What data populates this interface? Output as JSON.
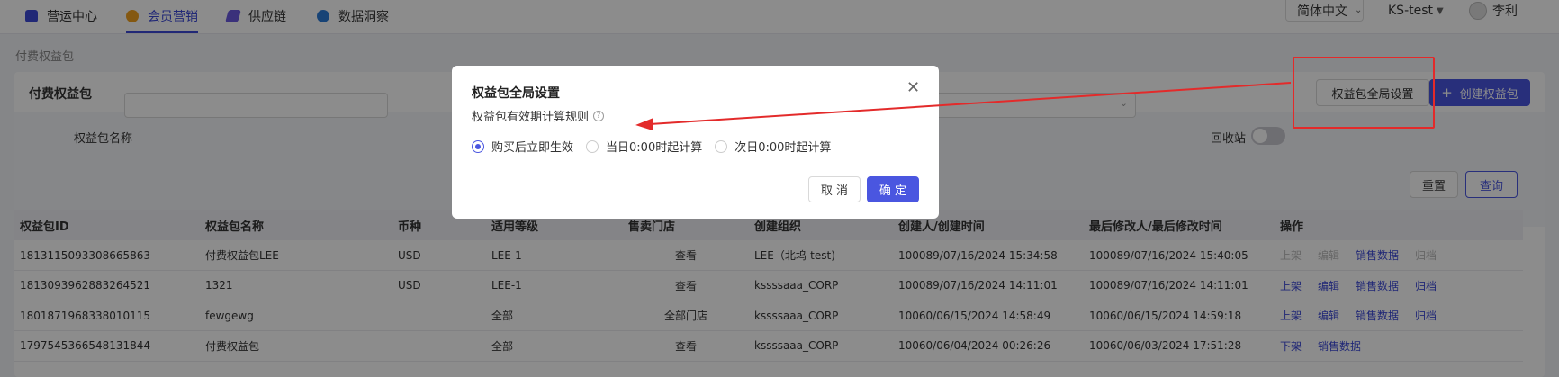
{
  "topbar": {
    "nav": [
      {
        "label": "营运中心",
        "icon": "operations-icon",
        "color": "#3d4ad8"
      },
      {
        "label": "会员营销",
        "icon": "member-marketing-icon",
        "color": "#f0a020"
      },
      {
        "label": "供应链",
        "icon": "supply-chain-icon",
        "color": "#6a5ae0"
      },
      {
        "label": "数据洞察",
        "icon": "data-insight-icon",
        "color": "#2b7ad8"
      }
    ],
    "active_nav_index": 1,
    "language": "简体中文",
    "tenant": "KS-test",
    "user": "李利"
  },
  "breadcrumb": "付费权益包",
  "card": {
    "title": "付费权益包",
    "global_settings_button": "权益包全局设置",
    "create_button": "创建权益包"
  },
  "filter": {
    "name_label": "权益包名称",
    "recycle_label": "回收站",
    "reset_button": "重置",
    "search_button": "查询"
  },
  "table": {
    "columns": [
      "权益包ID",
      "权益包名称",
      "币种",
      "适用等级",
      "售卖门店",
      "创建组织",
      "创建人/创建时间",
      "最后修改人/最后修改时间",
      "操作"
    ],
    "rows": [
      {
        "id": "1813115093308665863",
        "name": "付费权益包LEE",
        "currency": "USD",
        "level": "LEE-1",
        "store": "查看",
        "store_link": true,
        "org": "LEE（北坞-test)",
        "created": "100089/07/16/2024 15:34:58",
        "modified": "100089/07/16/2024 15:40:05",
        "actions": [
          {
            "label": "上架",
            "enabled": false
          },
          {
            "label": "编辑",
            "enabled": false
          },
          {
            "label": "销售数据",
            "enabled": true
          },
          {
            "label": "归档",
            "enabled": false
          }
        ]
      },
      {
        "id": "1813093962883264521",
        "name": "1321",
        "currency": "USD",
        "level": "LEE-1",
        "store": "查看",
        "store_link": true,
        "org": "kssssaaa_CORP",
        "created": "100089/07/16/2024 14:11:01",
        "modified": "100089/07/16/2024 14:11:01",
        "actions": [
          {
            "label": "上架",
            "enabled": true
          },
          {
            "label": "编辑",
            "enabled": true
          },
          {
            "label": "销售数据",
            "enabled": true
          },
          {
            "label": "归档",
            "enabled": true
          }
        ]
      },
      {
        "id": "1801871968338010115",
        "name": "fewgewg",
        "currency": "",
        "level": "全部",
        "store": "全部门店",
        "store_link": false,
        "org": "kssssaaa_CORP",
        "created": "10060/06/15/2024 14:58:49",
        "modified": "10060/06/15/2024 14:59:18",
        "actions": [
          {
            "label": "上架",
            "enabled": true
          },
          {
            "label": "编辑",
            "enabled": true
          },
          {
            "label": "销售数据",
            "enabled": true
          },
          {
            "label": "归档",
            "enabled": true
          }
        ]
      },
      {
        "id": "1797545366548131844",
        "name": "付费权益包",
        "currency": "",
        "level": "全部",
        "store": "查看",
        "store_link": true,
        "org": "kssssaaa_CORP",
        "created": "10060/06/04/2024 00:26:26",
        "modified": "10060/06/03/2024 17:51:28",
        "actions": [
          {
            "label": "下架",
            "enabled": true
          },
          {
            "label": "销售数据",
            "enabled": true
          }
        ]
      }
    ]
  },
  "dialog": {
    "title": "权益包全局设置",
    "rule_label": "权益包有效期计算规则",
    "options": [
      "购买后立即生效",
      "当日0:00时起计算",
      "次日0:00时起计算"
    ],
    "selected_index": 0,
    "cancel_button": "取 消",
    "ok_button": "确 定"
  },
  "colors": {
    "primary": "#4a56e0",
    "annotation": "#e32a2a"
  }
}
